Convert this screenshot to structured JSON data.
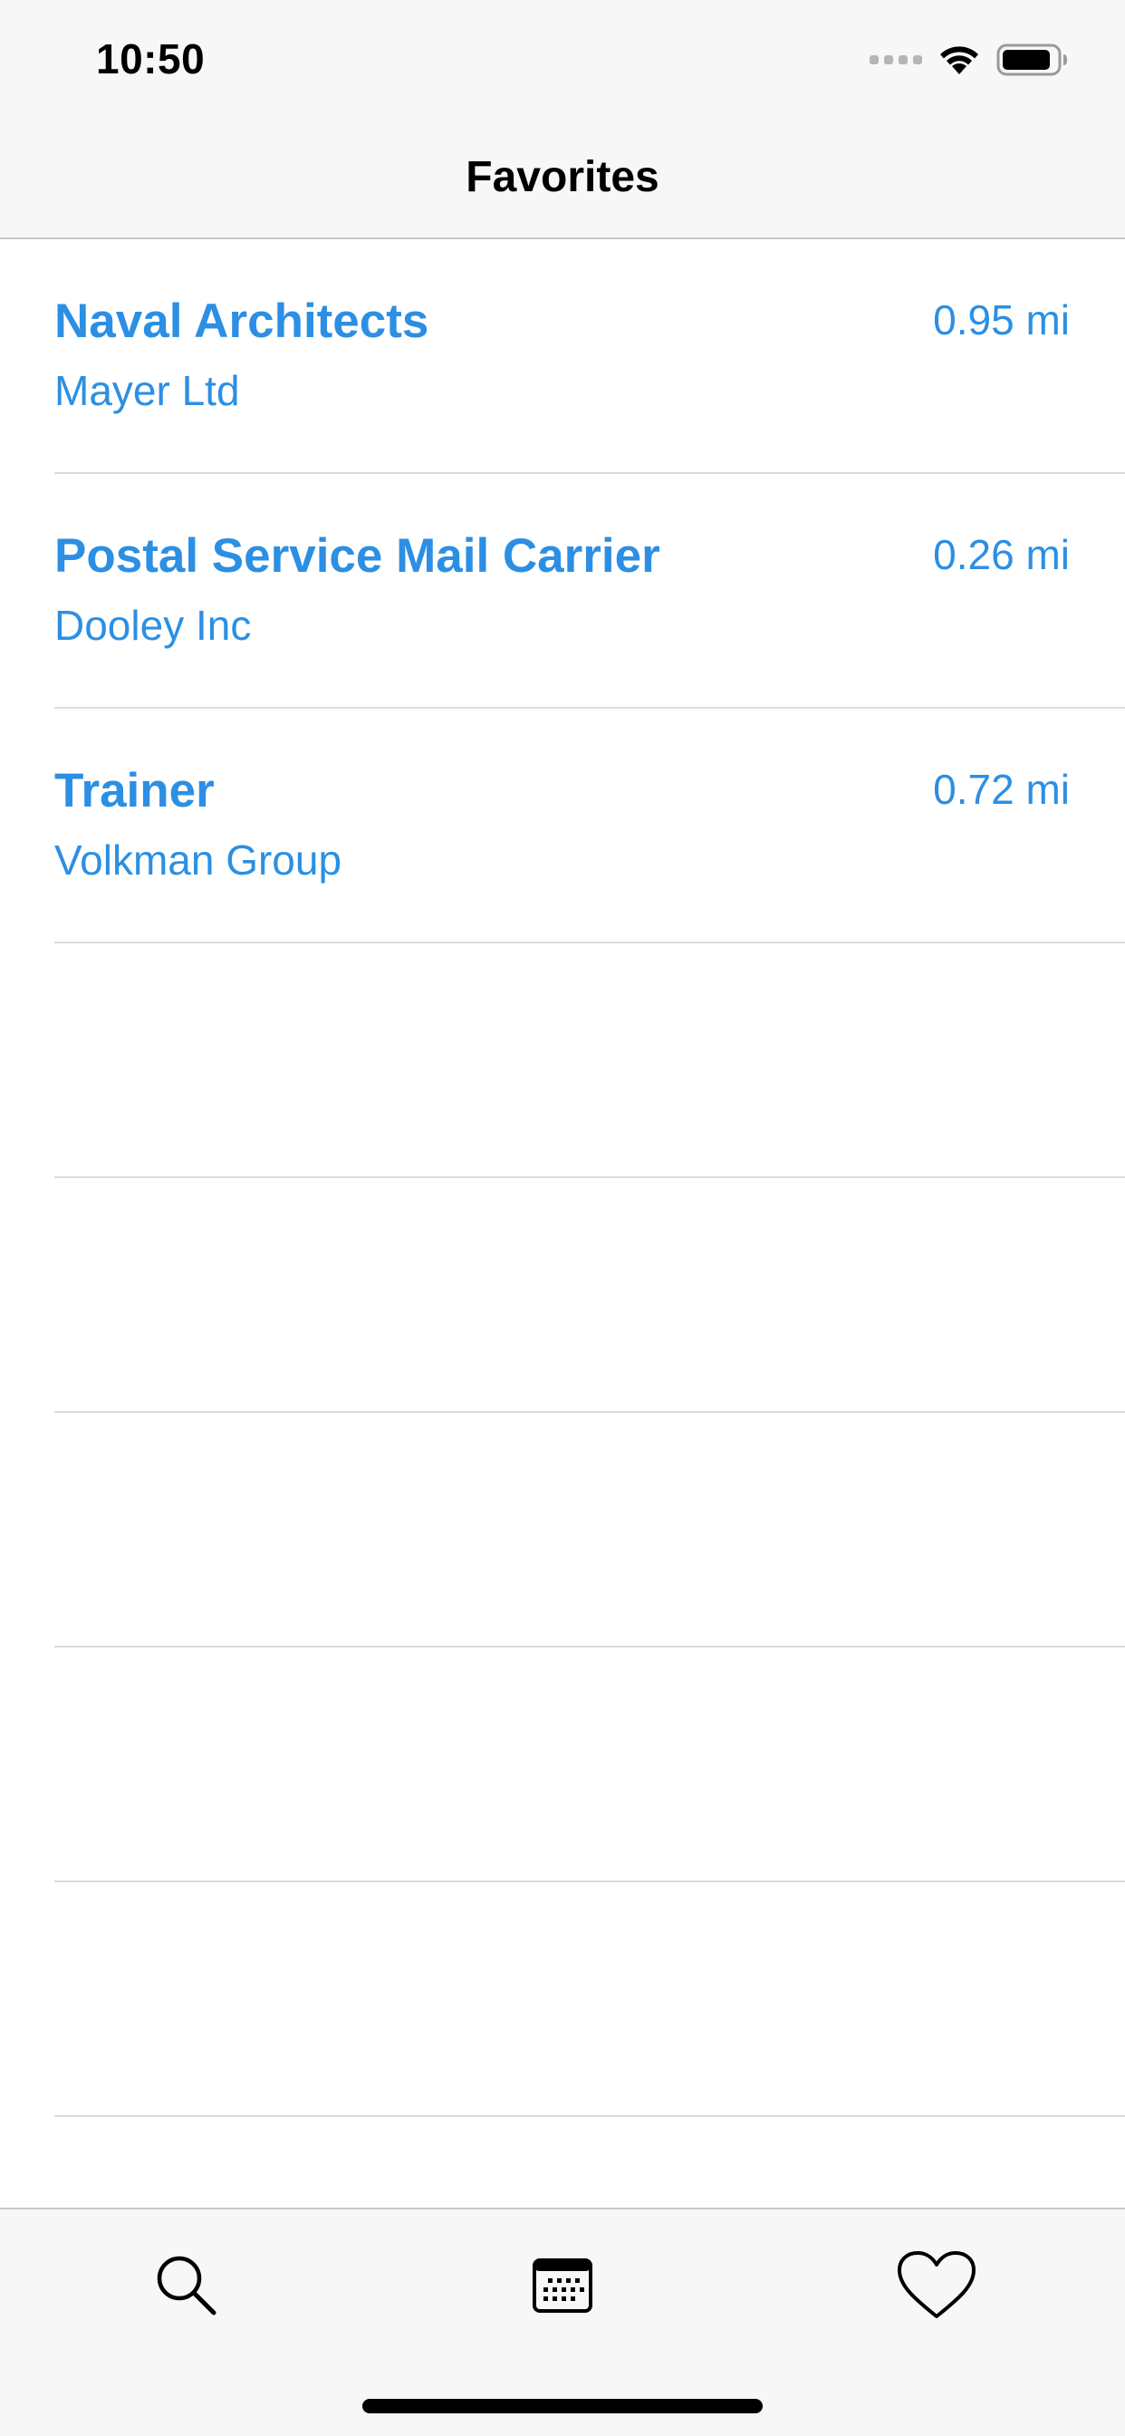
{
  "status_bar": {
    "time": "10:50"
  },
  "nav": {
    "title": "Favorites"
  },
  "favorites": [
    {
      "title": "Naval Architects",
      "company": "Mayer Ltd",
      "distance": "0.95 mi"
    },
    {
      "title": "Postal Service Mail Carrier",
      "company": "Dooley Inc",
      "distance": "0.26 mi"
    },
    {
      "title": "Trainer",
      "company": "Volkman Group",
      "distance": "0.72 mi"
    }
  ],
  "tabs": [
    {
      "icon": "search-icon"
    },
    {
      "icon": "calendar-icon"
    },
    {
      "icon": "heart-icon"
    }
  ],
  "colors": {
    "accent": "#2c8fe3",
    "bar_background": "#f7f7f7",
    "separator": "#dcdcdf"
  }
}
